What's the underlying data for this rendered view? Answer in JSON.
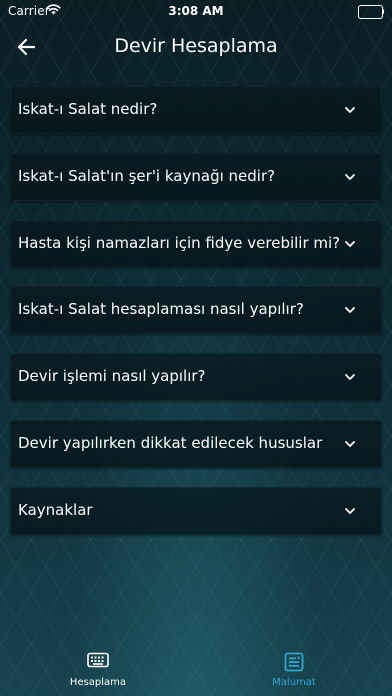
{
  "status_bar": {
    "carrier": "Carrier",
    "time": "3:08 AM"
  },
  "nav": {
    "title": "Devir Hesaplama"
  },
  "faq": {
    "items": [
      {
        "label": "Iskat-ı Salat nedir?"
      },
      {
        "label": "Iskat-ı Salat'ın şer'i kaynağı nedir?"
      },
      {
        "label": "Hasta kişi namazları için fidye verebilir mi?"
      },
      {
        "label": "Iskat-ı Salat hesaplaması nasıl yapılır?"
      },
      {
        "label": "Devir işlemi nasıl yapılır?"
      },
      {
        "label": "Devir yapılırken dikkat edilecek hususlar"
      },
      {
        "label": "Kaynaklar"
      }
    ]
  },
  "tab_bar": {
    "tabs": [
      {
        "label": "Hesaplama",
        "icon": "keyboard-icon",
        "active": false
      },
      {
        "label": "Malumat",
        "icon": "article-icon",
        "active": true
      }
    ]
  },
  "colors": {
    "active_tab": "#2fa6d0",
    "inactive_tab": "#ffffff",
    "item_background": "#07181e"
  }
}
